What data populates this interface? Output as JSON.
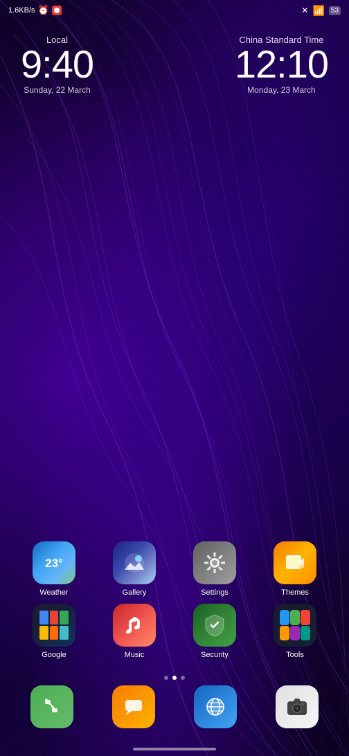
{
  "statusBar": {
    "speed": "1.6KB/s",
    "battery": "53",
    "batterySymbol": "🔋"
  },
  "clocks": [
    {
      "label": "Local",
      "time": "9:40",
      "date": "Sunday, 22 March"
    },
    {
      "label": "China Standard Time",
      "time": "12:10",
      "date": "Monday, 23 March"
    }
  ],
  "appRows": [
    [
      {
        "id": "weather",
        "label": "Weather"
      },
      {
        "id": "gallery",
        "label": "Gallery"
      },
      {
        "id": "settings",
        "label": "Settings"
      },
      {
        "id": "themes",
        "label": "Themes"
      }
    ],
    [
      {
        "id": "google",
        "label": "Google"
      },
      {
        "id": "music",
        "label": "Music"
      },
      {
        "id": "security",
        "label": "Security"
      },
      {
        "id": "tools",
        "label": "Tools"
      }
    ]
  ],
  "pageIndicators": [
    {
      "active": false
    },
    {
      "active": true
    },
    {
      "active": false
    }
  ],
  "dock": [
    {
      "id": "phone",
      "label": "Phone"
    },
    {
      "id": "messages",
      "label": "Messages"
    },
    {
      "id": "browser",
      "label": "Browser"
    },
    {
      "id": "camera",
      "label": "Camera"
    }
  ]
}
